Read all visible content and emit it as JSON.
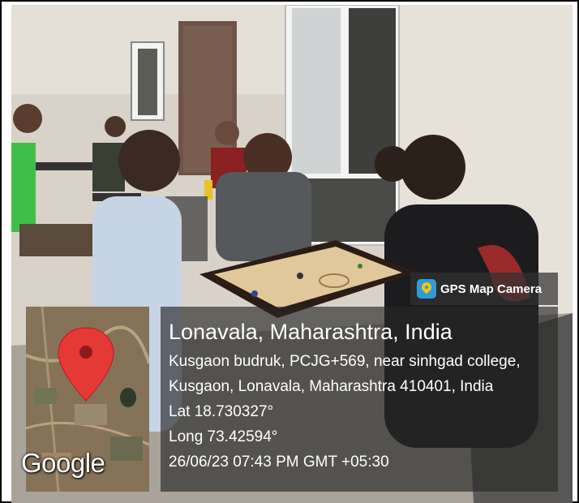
{
  "stamp": {
    "app_name": "GPS Map Camera",
    "app_icon": "map-pin-icon",
    "location_title": "Lonavala, Maharashtra, India",
    "address_line1": "Kusgaon budruk, PCJG+569, near sinhgad college,",
    "address_line2": "Kusgaon, Lonavala, Maharashtra 410401, India",
    "latitude": "Lat 18.730327°",
    "longitude": "Long 73.42594°",
    "datetime": "26/06/23 07:43 PM GMT +05:30"
  },
  "map": {
    "logo_text": "Google",
    "pin_icon": "location-pin-icon",
    "pin_color": "#e53935"
  },
  "colors": {
    "frame_border": "#000000",
    "overlay_bg": "#282828",
    "carrom_board": "#e0c89a"
  }
}
